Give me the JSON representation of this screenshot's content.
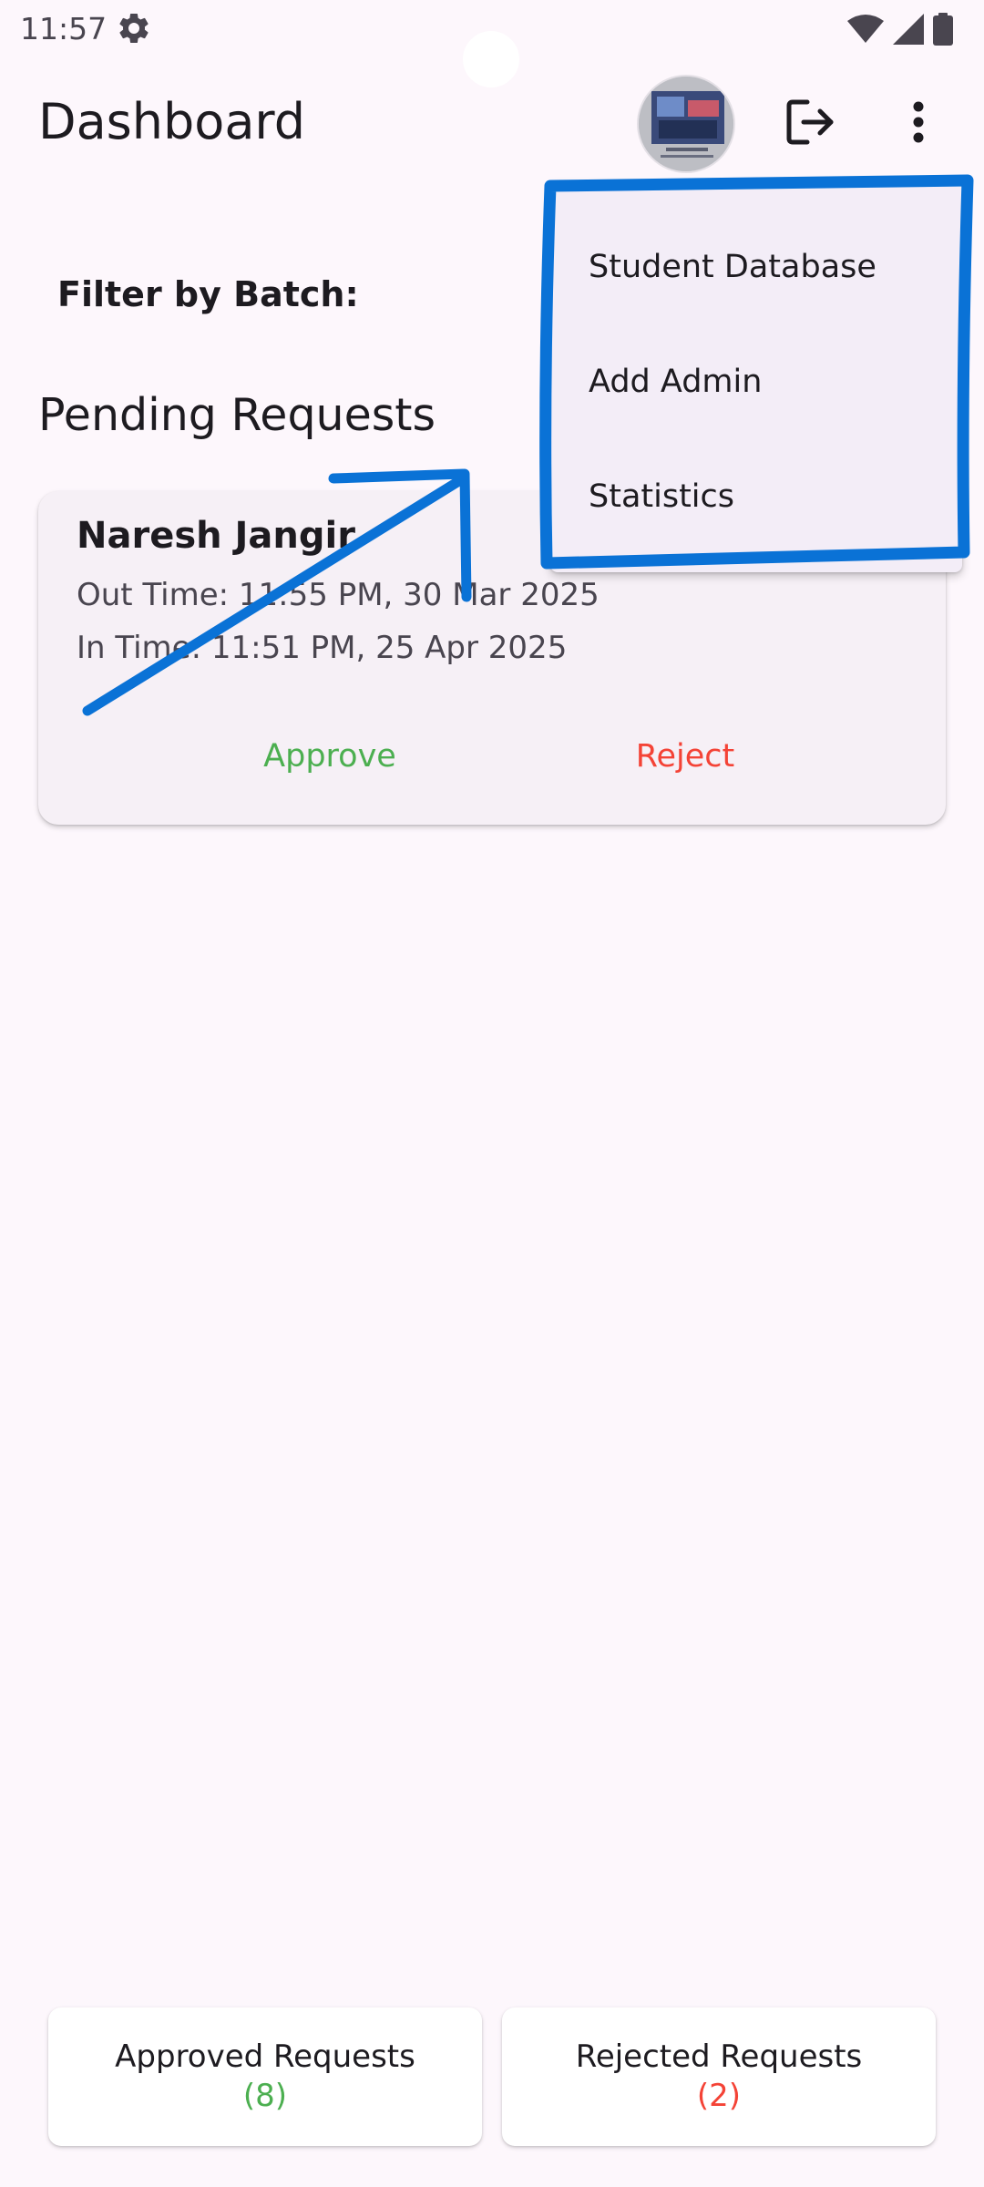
{
  "status_bar": {
    "time": "11:57",
    "icons": [
      "settings-gear-icon",
      "wifi-icon",
      "cellular-signal-icon",
      "battery-icon"
    ]
  },
  "app_bar": {
    "title": "Dashboard",
    "icons": [
      "avatar",
      "logout-icon",
      "more-vert-icon"
    ]
  },
  "filter": {
    "label": "Filter by Batch:"
  },
  "pending": {
    "title": "Pending Requests",
    "requests": [
      {
        "name": "Naresh Jangir",
        "out_time": "Out Time: 11:55 PM, 30 Mar 2025",
        "in_time": "In Time: 11:51 PM, 25 Apr 2025",
        "approve_label": "Approve",
        "reject_label": "Reject"
      }
    ]
  },
  "menu": {
    "items": [
      {
        "label": "Student Database"
      },
      {
        "label": "Add Admin"
      },
      {
        "label": "Statistics"
      }
    ]
  },
  "summary": {
    "approved_label": "Approved Requests",
    "approved_count": "(8)",
    "rejected_label": "Rejected Requests",
    "rejected_count": "(2)"
  },
  "colors": {
    "background": "#FDF7FC",
    "approve": "#4CAF50",
    "reject": "#F44336",
    "annotation": "#0A72D6",
    "menu_background": "#F3EDF7"
  }
}
